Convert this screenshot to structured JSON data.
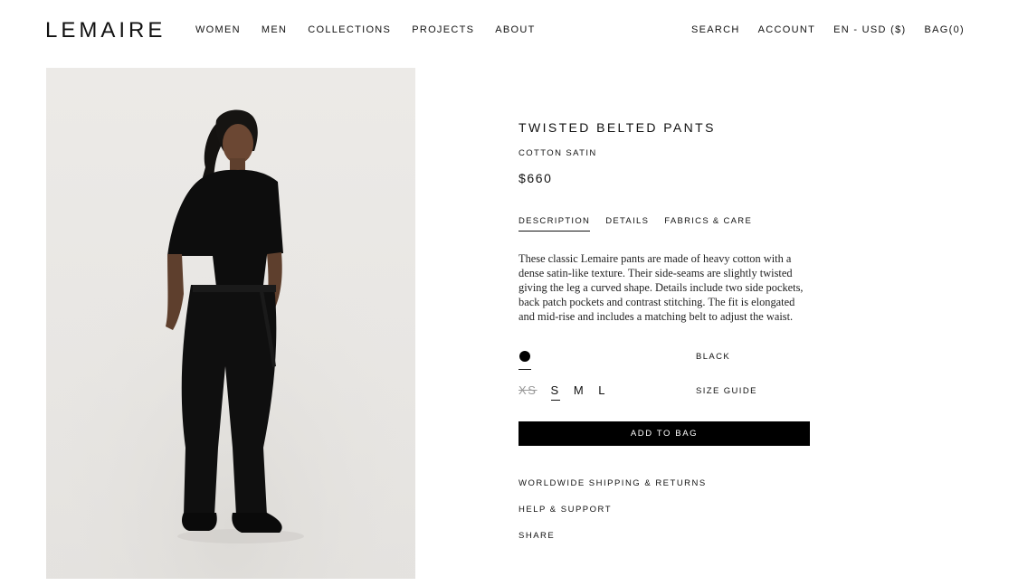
{
  "brand": {
    "logo": "LEMAIRE"
  },
  "nav": {
    "primary": [
      "WOMEN",
      "MEN",
      "COLLECTIONS",
      "PROJECTS",
      "ABOUT"
    ],
    "utility": [
      "SEARCH",
      "ACCOUNT",
      "EN - USD ($)",
      "BAG(0)"
    ]
  },
  "product": {
    "title": "TWISTED BELTED PANTS",
    "fabric": "COTTON SATIN",
    "price": "$660",
    "image_icon": "model-photo",
    "tabs": [
      {
        "label": "DESCRIPTION",
        "active": true
      },
      {
        "label": "DETAILS",
        "active": false
      },
      {
        "label": "FABRICS & CARE",
        "active": false
      }
    ],
    "description": "These classic Lemaire pants are made of heavy cotton with a dense satin-like texture. Their side-seams are slightly twisted giving the leg a curved shape. Details include two side pockets, back patch pockets and contrast stitching. The fit is elongated and mid-rise and includes a matching belt to adjust the waist.",
    "color": {
      "name": "BLACK",
      "swatch": "#000000"
    },
    "sizes": [
      {
        "label": "XS",
        "available": false,
        "selected": false
      },
      {
        "label": "S",
        "available": true,
        "selected": true
      },
      {
        "label": "M",
        "available": true,
        "selected": false
      },
      {
        "label": "L",
        "available": true,
        "selected": false
      }
    ],
    "size_guide_label": "SIZE GUIDE",
    "add_to_bag_label": "ADD TO BAG"
  },
  "info_links": [
    "WORLDWIDE SHIPPING & RETURNS",
    "HELP & SUPPORT",
    "SHARE"
  ]
}
